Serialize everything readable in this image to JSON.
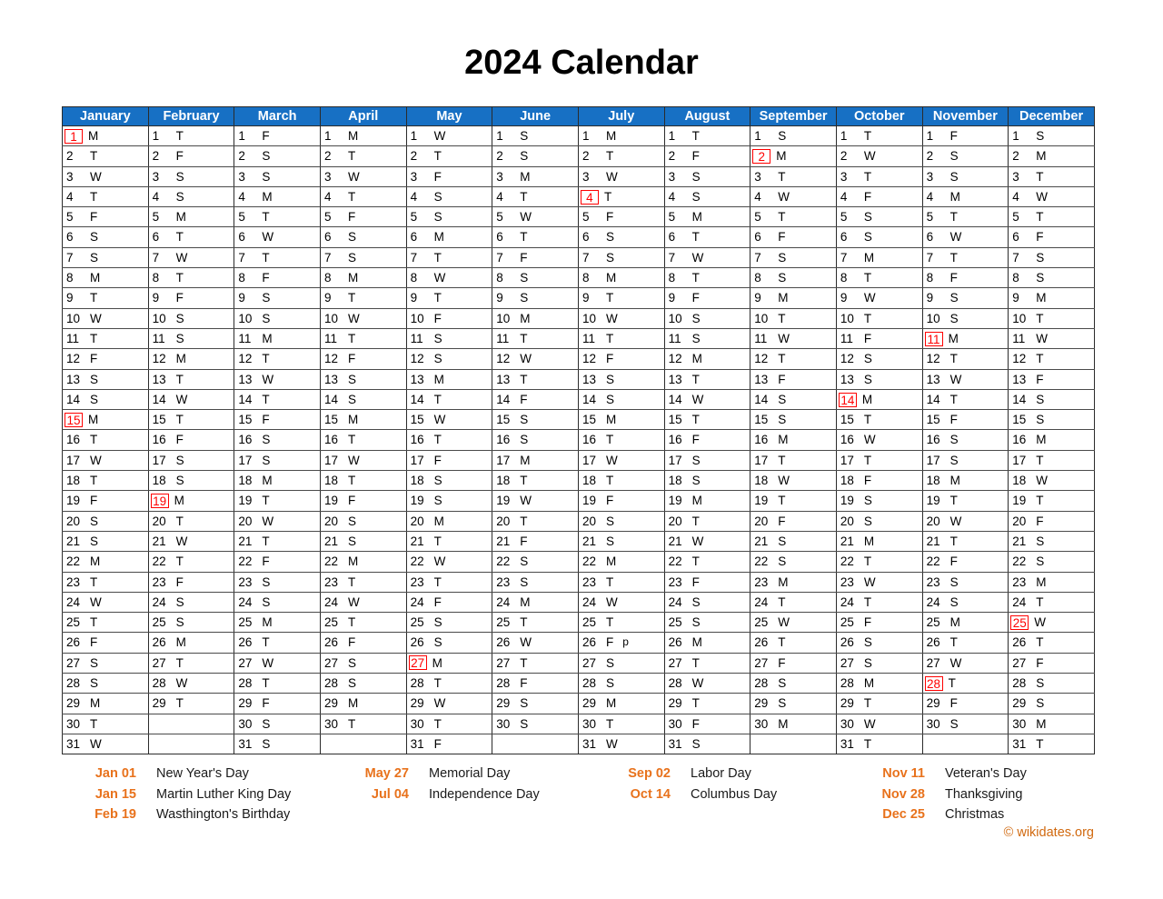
{
  "page": {
    "title": "2024 Calendar",
    "year": 2024,
    "credit": "© wikidates.org"
  },
  "colors": {
    "header_blue": "#1770C4",
    "saturday_gray": "#F3F3F3",
    "sunday_gray": "#D9D9D9",
    "holiday_red": "#FF0000",
    "legend_orange": "#E8721C",
    "credit_orange": "#D1690F",
    "grid_border": "#2B2B2B",
    "text": "#000000"
  },
  "calendar": {
    "weekday_letters": [
      "M",
      "T",
      "W",
      "T",
      "F",
      "S",
      "S"
    ],
    "max_rows": 31,
    "months": [
      {
        "name": "January",
        "days": 31,
        "first_weekday_index": 0
      },
      {
        "name": "February",
        "days": 29,
        "first_weekday_index": 3
      },
      {
        "name": "March",
        "days": 31,
        "first_weekday_index": 4
      },
      {
        "name": "April",
        "days": 30,
        "first_weekday_index": 0
      },
      {
        "name": "May",
        "days": 31,
        "first_weekday_index": 2
      },
      {
        "name": "June",
        "days": 30,
        "first_weekday_index": 5
      },
      {
        "name": "July",
        "days": 31,
        "first_weekday_index": 0
      },
      {
        "name": "August",
        "days": 31,
        "first_weekday_index": 3
      },
      {
        "name": "September",
        "days": 30,
        "first_weekday_index": 6
      },
      {
        "name": "October",
        "days": 31,
        "first_weekday_index": 1
      },
      {
        "name": "November",
        "days": 30,
        "first_weekday_index": 4
      },
      {
        "name": "December",
        "days": 31,
        "first_weekday_index": 6
      }
    ],
    "holiday_days": {
      "January": [
        1,
        15
      ],
      "February": [
        19
      ],
      "May": [
        27
      ],
      "July": [
        4
      ],
      "September": [
        2
      ],
      "October": [
        14
      ],
      "November": [
        11,
        28
      ],
      "December": [
        25
      ]
    },
    "cell_extras": {
      "July": {
        "26": "p"
      }
    }
  },
  "legend": {
    "columns": [
      [
        {
          "date": "Jan 01",
          "name": "New Year's Day"
        },
        {
          "date": "Jan 15",
          "name": "Martin Luther King Day"
        },
        {
          "date": "Feb 19",
          "name": "Wasthington's Birthday"
        }
      ],
      [
        {
          "date": "May 27",
          "name": "Memorial Day"
        },
        {
          "date": "Jul 04",
          "name": "Independence Day"
        }
      ],
      [
        {
          "date": "Sep 02",
          "name": "Labor Day"
        },
        {
          "date": "Oct 14",
          "name": "Columbus Day"
        }
      ],
      [
        {
          "date": "Nov 11",
          "name": "Veteran's Day"
        },
        {
          "date": "Nov 28",
          "name": "Thanksgiving"
        },
        {
          "date": "Dec 25",
          "name": "Christmas"
        }
      ]
    ]
  }
}
